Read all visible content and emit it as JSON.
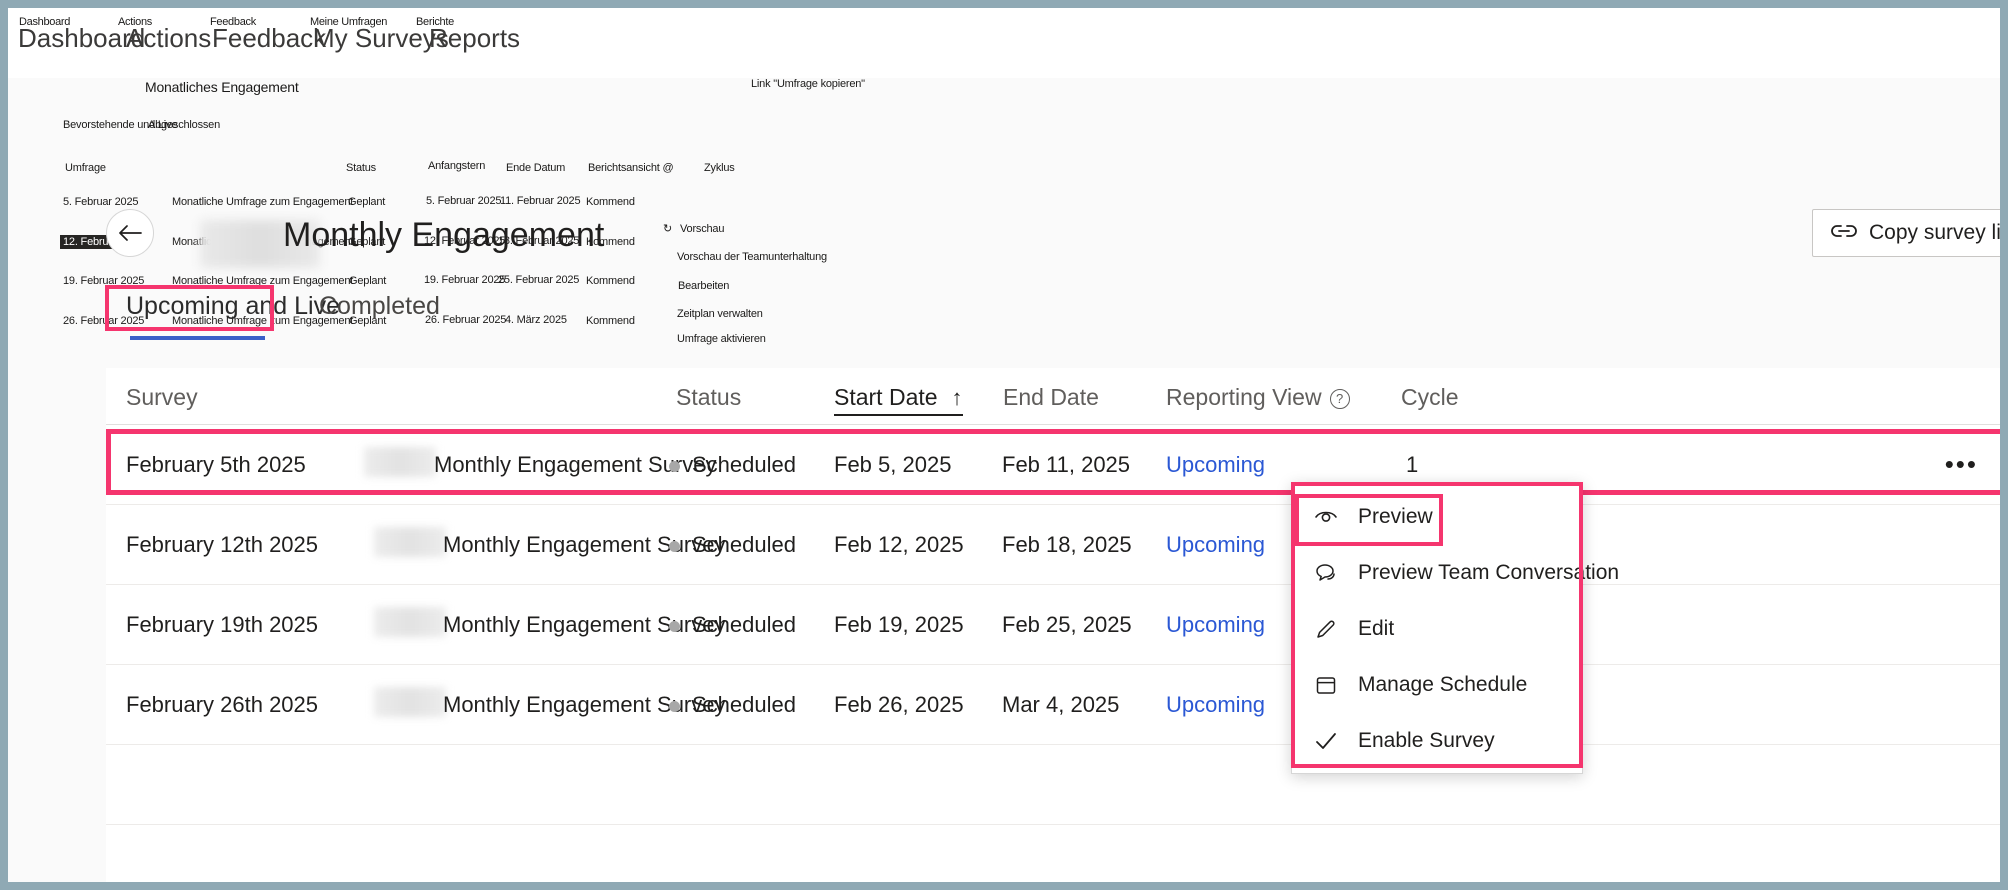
{
  "topnav": {
    "items_en": [
      "Dashboard",
      "Actions",
      "Feedback",
      "My Surveys",
      "Reports"
    ],
    "items_de": [
      "Dashboard",
      "Actions",
      "Feedback",
      "Meine Umfragen",
      "Berichte"
    ]
  },
  "overlay_de": {
    "section_title": "Monatliches Engagement",
    "tab_upcoming": "Bevorstehende und Live",
    "tab_completed": "Abgeschlossen",
    "col_survey": "Umfrage",
    "col_status": "Status",
    "col_start": "Anfangstern",
    "col_end": "Ende Datum",
    "col_reporting": "Berichtsansicht @",
    "col_cycle": "Zyklus",
    "copy_link": "Link \"Umfrage kopieren\"",
    "rows": [
      {
        "date": "5. Februar 2025",
        "survey": "Monatliche Umfrage zum Engagement",
        "status": "Geplant",
        "start": "5. Februar 2025",
        "end": "11. Februar 2025",
        "reporting": "Kommend"
      },
      {
        "date": "12. Februar 2025",
        "survey": "Monatliche Umfrage zum Engagement",
        "status": "Geplant",
        "start": "12. Februar 2025",
        "end": "18. Februar 2025",
        "reporting": "Kommend"
      },
      {
        "date": "19. Februar 2025",
        "survey": "Monatliche Umfrage zum Engagement",
        "status": "Geplant",
        "start": "19. Februar 2025",
        "end": "25. Februar 2025",
        "reporting": "Kommend"
      },
      {
        "date": "26. Februar 2025",
        "survey": "Monatliche Umfrage zum Engagement",
        "status": "Geplant",
        "start": "26. Februar 2025",
        "end": "4. März 2025",
        "reporting": "Kommend"
      }
    ],
    "menu": [
      "Vorschau",
      "Vorschau der Teamunterhaltung",
      "Bearbeiten",
      "Zeitplan verwalten",
      "Umfrage aktivieren"
    ]
  },
  "header": {
    "title": "Monthly Engagement",
    "back_icon": "back-arrow-icon",
    "copy_survey_link": "Copy survey link",
    "copy_link_icon": "link-icon"
  },
  "tabs": [
    {
      "label": "Upcoming and Live",
      "active": true
    },
    {
      "label": "Completed",
      "active": false
    }
  ],
  "table": {
    "columns": [
      {
        "key": "survey",
        "label": "Survey",
        "sorted": false
      },
      {
        "key": "status",
        "label": "Status",
        "sorted": false
      },
      {
        "key": "start",
        "label": "Start Date",
        "sorted": true,
        "sort_arrow": "↑"
      },
      {
        "key": "end",
        "label": "End Date",
        "sorted": false
      },
      {
        "key": "reporting",
        "label": "Reporting View",
        "sorted": false,
        "help_icon": "question-mark-icon"
      },
      {
        "key": "cycle",
        "label": "Cycle",
        "sorted": false
      }
    ],
    "rows": [
      {
        "survey_prefix": "February 5th 2025",
        "survey_suffix": "Monthly Engagement Survey",
        "status": "Scheduled",
        "start": "Feb 5, 2025",
        "end": "Feb 11, 2025",
        "reporting": "Upcoming",
        "cycle": "1",
        "menu_icon": "more-options-icon",
        "highlighted": true
      },
      {
        "survey_prefix": "February 12th 2025",
        "survey_suffix": "Monthly Engagement Survey",
        "status": "Scheduled",
        "start": "Feb 12, 2025",
        "end": "Feb 18, 2025",
        "reporting": "Upcoming",
        "cycle": "",
        "menu_icon": "more-options-icon",
        "highlighted": false
      },
      {
        "survey_prefix": "February 19th 2025",
        "survey_suffix": "Monthly Engagement Survey",
        "status": "Scheduled",
        "start": "Feb 19, 2025",
        "end": "Feb 25, 2025",
        "reporting": "Upcoming",
        "cycle": "",
        "menu_icon": "more-options-icon",
        "highlighted": false
      },
      {
        "survey_prefix": "February 26th 2025",
        "survey_suffix": "Monthly Engagement Survey",
        "status": "Scheduled",
        "start": "Feb 26, 2025",
        "end": "Mar 4, 2025",
        "reporting": "Upcoming",
        "cycle": "",
        "menu_icon": "more-options-icon",
        "highlighted": false
      }
    ]
  },
  "context_menu": {
    "items": [
      {
        "label": "Preview",
        "icon": "eye-icon",
        "highlighted": true
      },
      {
        "label": "Preview Team Conversation",
        "icon": "chat-icon",
        "highlighted": false
      },
      {
        "label": "Edit",
        "icon": "pencil-icon",
        "highlighted": false
      },
      {
        "label": "Manage Schedule",
        "icon": "calendar-icon",
        "highlighted": false
      },
      {
        "label": "Enable Survey",
        "icon": "checkmark-icon",
        "highlighted": false
      }
    ]
  },
  "colors": {
    "accent_pink": "#f5356e",
    "link_blue": "#2b58d4",
    "tab_underline": "#3a5fc8",
    "status_dot": "#a8a8a8",
    "page_bg": "#fafafa",
    "frame_bg": "#8fa9b4"
  }
}
